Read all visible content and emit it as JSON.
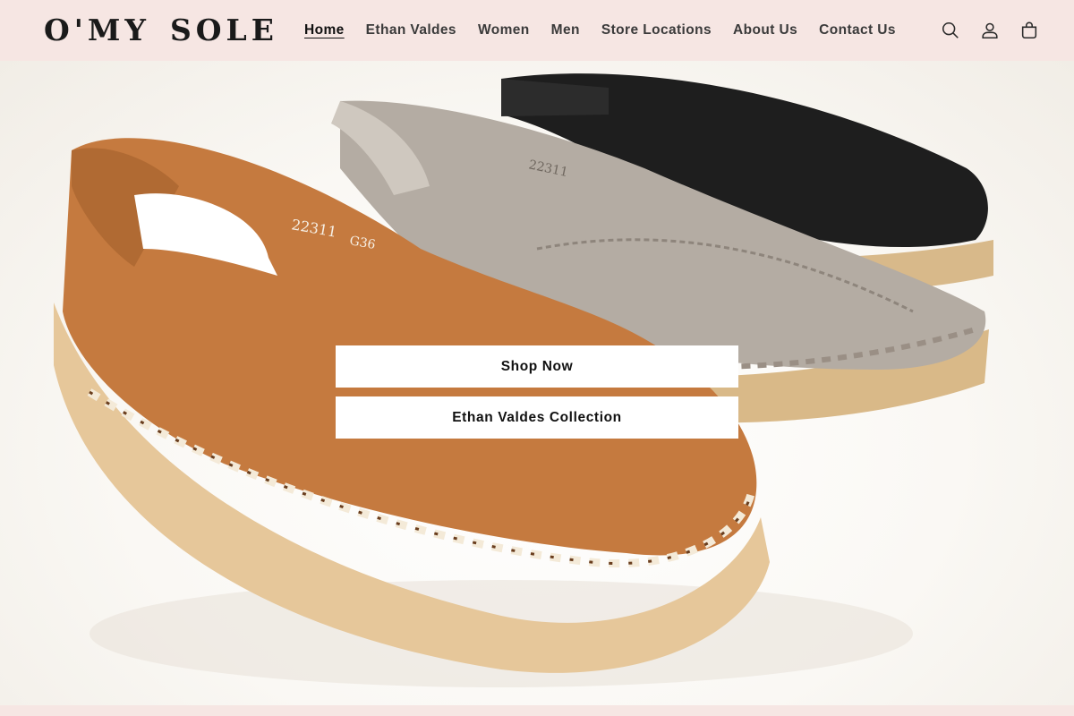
{
  "header": {
    "logo_part1": "O'MY",
    "logo_part2": "SOLE",
    "nav": [
      {
        "label": "Home",
        "active": true
      },
      {
        "label": "Ethan Valdes"
      },
      {
        "label": "Women"
      },
      {
        "label": "Men"
      },
      {
        "label": "Store Locations"
      },
      {
        "label": "About Us"
      },
      {
        "label": "Contact Us"
      }
    ],
    "icons": [
      "search-icon",
      "account-icon",
      "cart-icon"
    ]
  },
  "hero": {
    "image": "three-leather-sandals-cognac-taupe-black",
    "buttons": {
      "shop_now": "Shop Now",
      "collection": "Ethan Valdes Collection"
    },
    "sandal_imprint": {
      "code": "22311",
      "size_mark": "G36"
    }
  },
  "colors": {
    "header_bg": "#f6e6e3",
    "sandal_cognac": "#c57a3f",
    "sandal_taupe": "#b4aca3",
    "sandal_black": "#1e1e1e",
    "sole_crepe": "#e6c79a"
  }
}
